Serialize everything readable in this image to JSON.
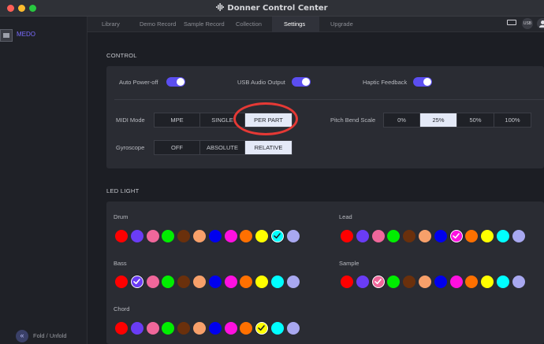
{
  "window": {
    "title": "Donner Control Center"
  },
  "sidebar": {
    "device_label": "MEDO",
    "fold_label": "Fold / Unfold"
  },
  "tabs": [
    {
      "label": "Library",
      "active": false
    },
    {
      "label": "Demo Record",
      "active": false
    },
    {
      "label": "Sample Record",
      "active": false
    },
    {
      "label": "Collection",
      "active": false
    },
    {
      "label": "Settings",
      "active": true
    },
    {
      "label": "Upgrade",
      "active": false
    }
  ],
  "topbar": {
    "usb_label": "USB",
    "battery_icon": "battery-charging-icon",
    "user_icon": "user-icon"
  },
  "control": {
    "section_title": "CONTROL",
    "toggles": [
      {
        "label": "Auto Power-off",
        "on": true
      },
      {
        "label": "USB Audio Output",
        "on": true
      },
      {
        "label": "Haptic Feedback",
        "on": true
      }
    ],
    "midi_mode": {
      "label": "MIDI Mode",
      "options": [
        "MPE",
        "SINGLE",
        "PER PART"
      ],
      "selected": "PER PART"
    },
    "pitch_bend": {
      "label": "Pitch Bend Scale",
      "options": [
        "0%",
        "25%",
        "50%",
        "100%"
      ],
      "selected": "25%"
    },
    "gyroscope": {
      "label": "Gyroscope",
      "options": [
        "OFF",
        "ABSOLUTE",
        "RELATIVE"
      ],
      "selected": "RELATIVE"
    },
    "accent_color": "#5b4ef0"
  },
  "led": {
    "section_title": "LED LIGHT",
    "palette": [
      "#ff0000",
      "#6a3cf5",
      "#f0679b",
      "#00ee00",
      "#6a300c",
      "#f7a06a",
      "#0000ee",
      "#ff10e0",
      "#ff7000",
      "#ffff00",
      "#00ffff",
      "#a8a8f0"
    ],
    "groups": [
      {
        "label": "Drum",
        "selected_index": 10
      },
      {
        "label": "Lead",
        "selected_index": 7
      },
      {
        "label": "Bass",
        "selected_index": 1
      },
      {
        "label": "Sample",
        "selected_index": 2
      },
      {
        "label": "Chord",
        "selected_index": 9
      }
    ]
  },
  "annotation": {
    "highlight_color": "#e53935"
  }
}
